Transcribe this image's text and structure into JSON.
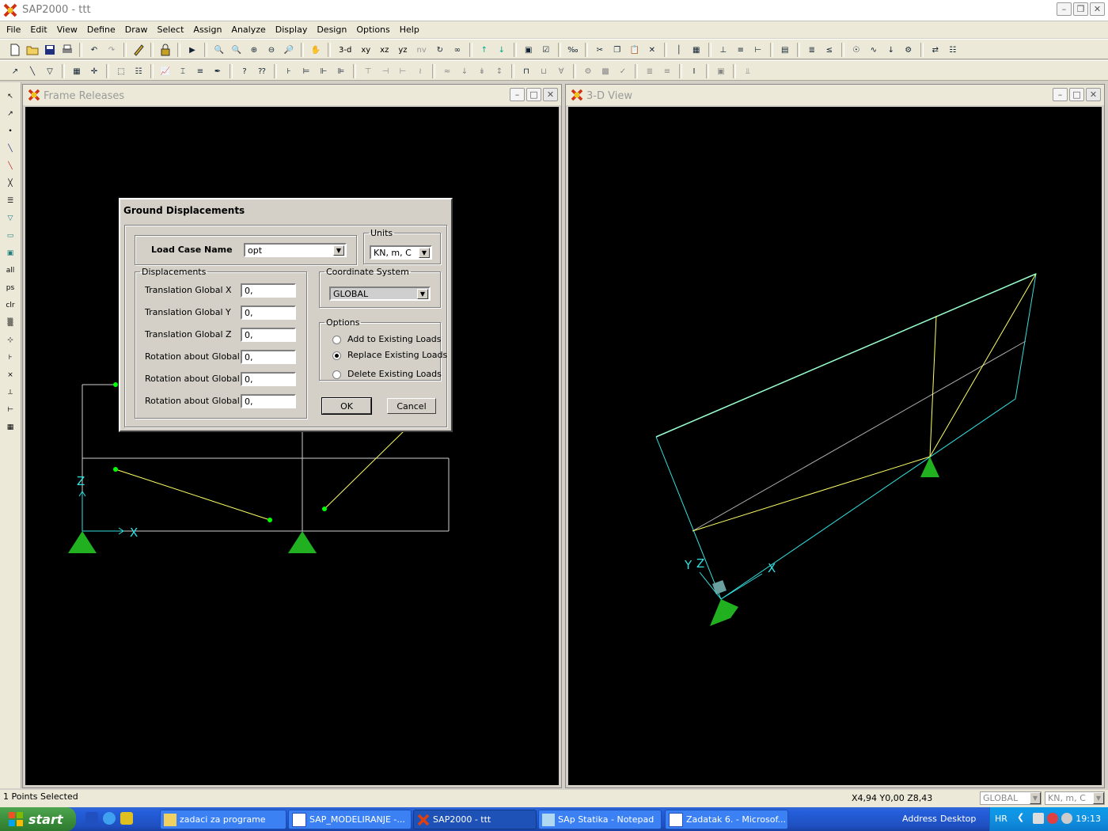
{
  "app": {
    "title": "SAP2000 - ttt"
  },
  "menu": [
    "File",
    "Edit",
    "View",
    "Define",
    "Draw",
    "Select",
    "Assign",
    "Analyze",
    "Display",
    "Design",
    "Options",
    "Help"
  ],
  "toolbar": {
    "view_labels": [
      "3-d",
      "xy",
      "xz",
      "yz",
      "nv"
    ]
  },
  "left_toolbar": {
    "labels": [
      "all",
      "ps",
      "clr"
    ]
  },
  "windows": {
    "frame_releases": {
      "title": "Frame Releases",
      "axis_x": "X",
      "axis_z": "Z"
    },
    "view_3d": {
      "title": "3-D View",
      "axis_x": "X",
      "axis_y": "Y",
      "axis_z": "Z"
    }
  },
  "dialog": {
    "title": "Ground Displacements",
    "load_case_label": "Load Case Name",
    "load_case_value": "opt",
    "units_legend": "Units",
    "units_value": "KN, m, C",
    "displacements_legend": "Displacements",
    "fields": [
      {
        "label": "Translation Global X",
        "value": "0,"
      },
      {
        "label": "Translation Global Y",
        "value": "0,"
      },
      {
        "label": "Translation Global Z",
        "value": "0,"
      },
      {
        "label": "Rotation about Global X",
        "value": "0,"
      },
      {
        "label": "Rotation about Global Y",
        "value": "0,"
      },
      {
        "label": "Rotation about Global Z",
        "value": "0,"
      }
    ],
    "coord_legend": "Coordinate System",
    "coord_value": "GLOBAL",
    "options_legend": "Options",
    "options": [
      {
        "label": "Add to Existing Loads",
        "selected": false
      },
      {
        "label": "Replace Existing Loads",
        "selected": true
      },
      {
        "label": "Delete Existing Loads",
        "selected": false
      }
    ],
    "ok": "OK",
    "cancel": "Cancel"
  },
  "status": {
    "selection": "1 Points Selected",
    "coords": "X4,94  Y0,00  Z8,43",
    "coord_system": "GLOBAL",
    "units": "KN, m, C"
  },
  "taskbar": {
    "start": "start",
    "tasks": [
      "zadaci za programe",
      "SAP_MODELIRANJE -...",
      "SAP2000 - ttt",
      "SAp Statika - Notepad",
      "Zadatak 6. - Microsof..."
    ],
    "address": "Address",
    "desktop": "Desktop",
    "lang": "HR",
    "clock": "19:13"
  },
  "colors": {
    "canvas": "#000000",
    "member": "#ffff66",
    "frame_3d": "#33e0e0",
    "node": "#00ff00",
    "support": "#20b020"
  }
}
